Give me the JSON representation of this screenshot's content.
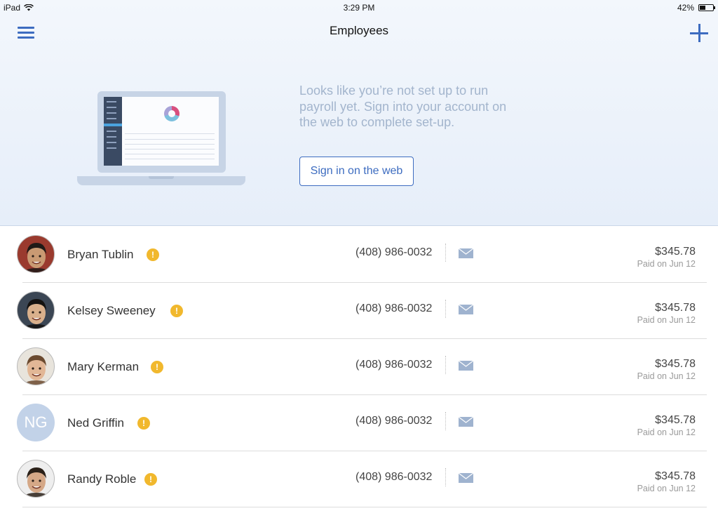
{
  "status_bar": {
    "device": "iPad",
    "time": "3:29 PM",
    "battery_percent": "42%",
    "battery_level": 0.42
  },
  "nav": {
    "title": "Employees",
    "menu_icon": "hamburger-menu-icon",
    "add_icon": "plus-icon",
    "accent_color": "#3d6cc0"
  },
  "hero": {
    "message": "Looks like you’re not set up to run payroll yet. Sign into your account on the web to complete set-up.",
    "signin_label": "Sign in on the web",
    "illustration": "laptop-dashboard-illustration"
  },
  "employees": [
    {
      "name": "Bryan Tublin",
      "phone": "(408) 986-0032",
      "amount": "$345.78",
      "paid": "Paid on Jun 12",
      "initials": "",
      "photo_skin": "#c99a73",
      "photo_hair": "#1f1a17",
      "photo_bg": "#9a3a2e"
    },
    {
      "name": "Kelsey Sweeney",
      "phone": "(408) 986-0032",
      "amount": "$345.78",
      "paid": "Paid on Jun 12",
      "initials": "",
      "photo_skin": "#d9b08c",
      "photo_hair": "#141210",
      "photo_bg": "#3b4654"
    },
    {
      "name": "Mary Kerman",
      "phone": "(408) 986-0032",
      "amount": "$345.78",
      "paid": "Paid on Jun 12",
      "initials": "",
      "photo_skin": "#e2b796",
      "photo_hair": "#6b4a2f",
      "photo_bg": "#e8e4dc"
    },
    {
      "name": "Ned Griffin",
      "phone": "(408) 986-0032",
      "amount": "$345.78",
      "paid": "Paid on Jun 12",
      "initials": "NG",
      "photo_skin": "",
      "photo_hair": "",
      "photo_bg": "#c2d2e8"
    },
    {
      "name": "Randy Roble",
      "phone": "(408) 986-0032",
      "amount": "$345.78",
      "paid": "Paid on Jun 12",
      "initials": "",
      "photo_skin": "#d5a887",
      "photo_hair": "#2a2018",
      "photo_bg": "#eeeeee"
    }
  ],
  "row_icons": {
    "warning": "warning-icon",
    "warning_color": "#f1b82d",
    "mail": "mail-icon",
    "mail_color": "#9fb3cf"
  }
}
